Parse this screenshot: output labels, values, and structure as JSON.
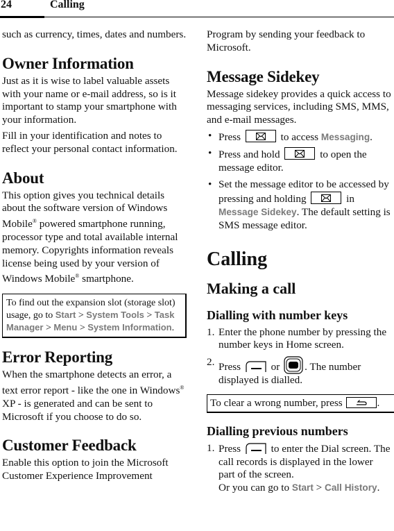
{
  "header": {
    "page_number": "24",
    "chapter": "Calling"
  },
  "left": {
    "intro_continuation": "such as currency, times, dates and numbers.",
    "owner": {
      "title": "Owner Information",
      "p1": "Just as it is wise to label valuable assets with your name or e-mail address, so is it important to stamp your smartphone with your information.",
      "p2": "Fill in your identification and notes to reflect your personal contact information."
    },
    "about": {
      "title": "About",
      "p1_a": "This option gives you technical details about the software version of Windows Mobile",
      "reg": "®",
      "p1_b": " powered smartphone running, processor type and total available internal memory. Copyrights information reveals license being used by your version of Windows Mobile",
      "p1_c": " smartphone."
    },
    "note": {
      "text_a": "To find out the expansion slot (storage slot) usage, go to ",
      "path": [
        "Start",
        "System Tools",
        "Task Manager",
        "Menu",
        "System Information"
      ],
      "sep": " > ",
      "end": "."
    },
    "error": {
      "title": "Error Reporting",
      "p_a": "When the smartphone detects an error, a text error report - like the one in Windows",
      "p_b": "  XP - is generated and can be sent to Microsoft if you choose to do so."
    },
    "feedback": {
      "title": "Customer Feedback",
      "p": "Enable this option to join the Microsoft Customer Experience Improvement"
    }
  },
  "right": {
    "feedback_continuation": "Program by sending your feedback to Microsoft.",
    "sidekey": {
      "title": "Message Sidekey",
      "p": "Message sidekey provides a quick access to messaging services, including SMS, MMS, and e-mail messages.",
      "bullets": [
        {
          "pre": "Press",
          "post": " to access ",
          "ui": "Messaging",
          "end": "."
        },
        {
          "pre": "Press and hold",
          "post": " to open the message editor."
        },
        {
          "pre": "Set the message editor to be accessed by pressing and holding",
          "post": " in ",
          "ui": "Message Sidekey",
          "end": ". The default setting is SMS message editor."
        }
      ]
    },
    "calling": {
      "title": "Calling",
      "making_call": "Making a call",
      "dial_keys": {
        "title": "Dialling with number keys",
        "steps": [
          {
            "n": "1.",
            "text": "Enter the phone number by pressing the number keys in Home screen."
          },
          {
            "n": "2.",
            "pre": "Press",
            "mid": " or ",
            "post": ". The number displayed is dialled."
          }
        ],
        "note_pre": "To clear a wrong number, press",
        "note_end": "."
      },
      "dial_prev": {
        "title": "Dialling previous numbers",
        "steps": [
          {
            "n": "1.",
            "pre": "Press",
            "post": " to enter the Dial screen. The call records is displayed in the lower part of the screen.",
            "line2": "Or you can go to ",
            "path": [
              "Start",
              "Call History"
            ],
            "sep": " > ",
            "end": "."
          }
        ]
      }
    }
  },
  "icons": {
    "envelope_key": "envelope-key-icon",
    "send_softkey": "send-softkey-icon",
    "call_key": "call-key-icon",
    "back_key": "back-key-icon"
  },
  "colors": {
    "ui_text": "#7a7a7a",
    "body_text": "#111111"
  }
}
